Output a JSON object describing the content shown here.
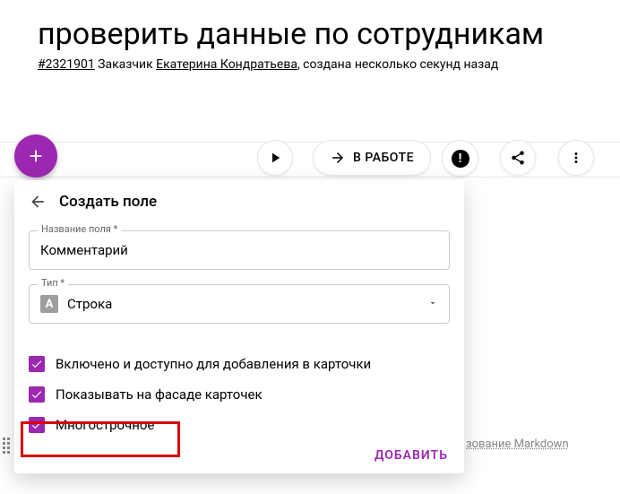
{
  "header": {
    "title": "проверить данные по сотрудникам",
    "task_id": "#2321901",
    "customer_label": " Заказчик ",
    "customer_name": "Екатерина Кондратьева",
    "created_text": ", создана несколько секунд назад"
  },
  "actions": {
    "in_work_label": "В РАБОТЕ"
  },
  "panel": {
    "title": "Создать поле",
    "name_label": "Название поля *",
    "name_value": "Комментарий",
    "type_label": "Тип *",
    "type_icon_letter": "A",
    "type_value": "Строка",
    "checkboxes": [
      "Включено и доступно для добавления в карточки",
      "Показывать на фасаде карточек",
      "Многострочное"
    ],
    "submit_label": "ДОБАВИТЬ"
  },
  "background": {
    "markdown_hint": "зование Markdown"
  }
}
